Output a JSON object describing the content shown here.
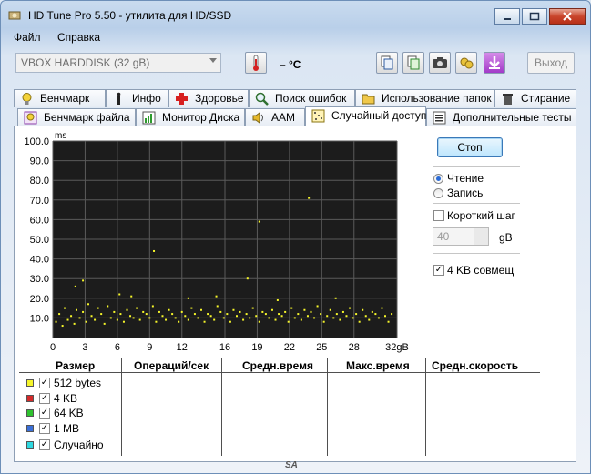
{
  "window": {
    "title": "HD Tune Pro 5.50 - утилита для HD/SSD"
  },
  "menu": {
    "file": "Файл",
    "help": "Справка"
  },
  "toolbar": {
    "drive": "VBOX HARDDISK (32 gB)",
    "temperature": "– °C",
    "exit_label": "Выход"
  },
  "tabs_row1": [
    {
      "label": "Бенчмарк",
      "icon": "bulb-icon"
    },
    {
      "label": "Инфо",
      "icon": "info-icon"
    },
    {
      "label": "Здоровье",
      "icon": "health-cross-icon"
    },
    {
      "label": "Поиск ошибок",
      "icon": "magnifier-icon"
    },
    {
      "label": "Использование папок",
      "icon": "folder-icon"
    },
    {
      "label": "Стирание",
      "icon": "trash-icon"
    }
  ],
  "tabs_row2": [
    {
      "label": "Бенчмарк файла",
      "icon": "bulb-file-icon"
    },
    {
      "label": "Монитор Диска",
      "icon": "monitor-chart-icon"
    },
    {
      "label": "AAM",
      "icon": "speaker-icon"
    },
    {
      "label": "Случайный доступ",
      "icon": "random-access-icon",
      "active": true
    },
    {
      "label": "Дополнительные тесты",
      "icon": "extra-tests-icon"
    }
  ],
  "controls": {
    "stop_label": "Стоп",
    "read_label": "Чтение",
    "write_label": "Запись",
    "short_stroke_label": "Короткий шаг",
    "short_stroke_value": "40",
    "short_stroke_unit": "gB",
    "align_label": "4 KB совмещ",
    "mode_selected": "Чтение",
    "short_stroke_checked": false,
    "align_checked": true
  },
  "table": {
    "headers": [
      "Размер",
      "Операций/сек",
      "Средн.время",
      "Макс.время",
      "Средн.скорость"
    ],
    "rows": [
      {
        "label": "512 bytes",
        "color": "#f5f52a",
        "checked": true
      },
      {
        "label": "4 KB",
        "color": "#d42a2a",
        "checked": true
      },
      {
        "label": "64 KB",
        "color": "#2fc32f",
        "checked": true
      },
      {
        "label": "1 MB",
        "color": "#3a6fd8",
        "checked": true
      },
      {
        "label": "Случайно",
        "color": "#2fd8e0",
        "checked": true
      }
    ]
  },
  "chart_data": {
    "type": "scatter",
    "ylabel": "ms",
    "yticks": [
      "100.0",
      "90.0",
      "80.0",
      "70.0",
      "60.0",
      "50.0",
      "40.0",
      "30.0",
      "20.0",
      "10.0"
    ],
    "xticks": [
      "0",
      "3",
      "6",
      "9",
      "12",
      "16",
      "19",
      "22",
      "25",
      "28",
      "32gB"
    ],
    "xlim": [
      0,
      32
    ],
    "ylim": [
      0,
      100
    ],
    "grid": true,
    "background": "#1c1c1c",
    "series": [
      {
        "name": "512 bytes",
        "color": "#f5f52a",
        "points": [
          [
            0.3,
            8
          ],
          [
            0.6,
            12
          ],
          [
            0.9,
            6
          ],
          [
            1.1,
            15
          ],
          [
            1.4,
            9
          ],
          [
            1.7,
            11
          ],
          [
            2.0,
            7
          ],
          [
            2.2,
            14
          ],
          [
            2.5,
            10
          ],
          [
            2.8,
            13
          ],
          [
            3.1,
            8
          ],
          [
            3.3,
            17
          ],
          [
            3.6,
            11
          ],
          [
            3.9,
            9
          ],
          [
            4.2,
            15
          ],
          [
            4.5,
            12
          ],
          [
            4.8,
            7
          ],
          [
            5.1,
            16
          ],
          [
            5.4,
            10
          ],
          [
            5.7,
            13
          ],
          [
            6.0,
            9
          ],
          [
            6.3,
            12
          ],
          [
            6.6,
            8
          ],
          [
            6.9,
            14
          ],
          [
            7.2,
            11
          ],
          [
            7.5,
            10
          ],
          [
            7.8,
            15
          ],
          [
            8.1,
            9
          ],
          [
            8.4,
            13
          ],
          [
            8.7,
            12
          ],
          [
            9.0,
            10
          ],
          [
            9.3,
            16
          ],
          [
            9.6,
            8
          ],
          [
            9.9,
            13
          ],
          [
            10.2,
            11
          ],
          [
            10.5,
            9
          ],
          [
            10.8,
            14
          ],
          [
            11.1,
            12
          ],
          [
            11.4,
            10
          ],
          [
            11.7,
            8
          ],
          [
            12.0,
            13
          ],
          [
            12.3,
            11
          ],
          [
            12.6,
            9
          ],
          [
            12.9,
            15
          ],
          [
            13.2,
            12
          ],
          [
            13.5,
            10
          ],
          [
            13.8,
            14
          ],
          [
            14.1,
            8
          ],
          [
            14.4,
            12
          ],
          [
            14.7,
            11
          ],
          [
            15.0,
            9
          ],
          [
            15.3,
            16
          ],
          [
            15.6,
            13
          ],
          [
            15.9,
            10
          ],
          [
            16.2,
            12
          ],
          [
            16.5,
            8
          ],
          [
            16.8,
            14
          ],
          [
            17.1,
            11
          ],
          [
            17.4,
            13
          ],
          [
            17.7,
            9
          ],
          [
            18.0,
            12
          ],
          [
            18.3,
            10
          ],
          [
            18.6,
            15
          ],
          [
            18.9,
            11
          ],
          [
            19.2,
            8
          ],
          [
            19.5,
            13
          ],
          [
            19.8,
            12
          ],
          [
            20.1,
            10
          ],
          [
            20.4,
            14
          ],
          [
            20.7,
            9
          ],
          [
            21.0,
            12
          ],
          [
            21.3,
            11
          ],
          [
            21.6,
            13
          ],
          [
            21.9,
            8
          ],
          [
            22.2,
            15
          ],
          [
            22.5,
            10
          ],
          [
            22.8,
            12
          ],
          [
            23.1,
            9
          ],
          [
            23.4,
            14
          ],
          [
            23.7,
            11
          ],
          [
            24.0,
            13
          ],
          [
            24.3,
            10
          ],
          [
            24.6,
            16
          ],
          [
            24.9,
            12
          ],
          [
            25.2,
            8
          ],
          [
            25.5,
            11
          ],
          [
            25.8,
            14
          ],
          [
            26.1,
            10
          ],
          [
            26.4,
            12
          ],
          [
            26.7,
            9
          ],
          [
            27.0,
            13
          ],
          [
            27.3,
            11
          ],
          [
            27.6,
            15
          ],
          [
            27.9,
            10
          ],
          [
            28.2,
            12
          ],
          [
            28.5,
            8
          ],
          [
            28.8,
            14
          ],
          [
            29.1,
            11
          ],
          [
            29.4,
            9
          ],
          [
            29.7,
            13
          ],
          [
            30.0,
            12
          ],
          [
            30.3,
            10
          ],
          [
            30.6,
            15
          ],
          [
            30.9,
            11
          ],
          [
            31.2,
            8
          ],
          [
            31.5,
            12
          ],
          [
            2.1,
            26
          ],
          [
            2.8,
            29
          ],
          [
            7.3,
            21
          ],
          [
            9.4,
            44
          ],
          [
            18.1,
            30
          ],
          [
            19.2,
            59
          ],
          [
            23.8,
            71
          ],
          [
            6.2,
            22
          ],
          [
            12.6,
            20
          ],
          [
            15.2,
            21
          ],
          [
            20.9,
            19
          ],
          [
            26.3,
            20
          ]
        ]
      }
    ]
  }
}
